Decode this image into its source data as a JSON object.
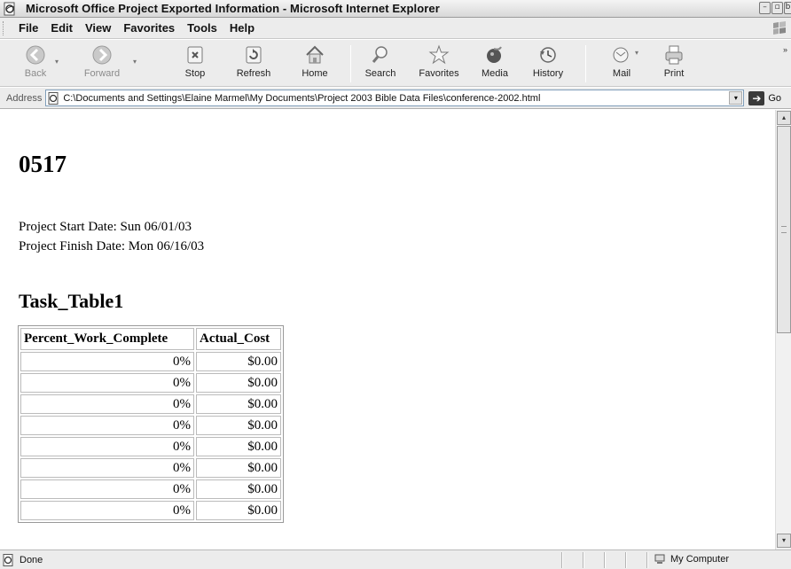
{
  "window": {
    "title": "Microsoft Office Project Exported Information - Microsoft Internet Explorer"
  },
  "menu": [
    "File",
    "Edit",
    "View",
    "Favorites",
    "Tools",
    "Help"
  ],
  "toolbar": {
    "back": "Back",
    "forward": "Forward",
    "stop": "Stop",
    "refresh": "Refresh",
    "home": "Home",
    "search": "Search",
    "favorites": "Favorites",
    "media": "Media",
    "history": "History",
    "mail": "Mail",
    "print": "Print"
  },
  "address": {
    "label": "Address",
    "url": "C:\\Documents and Settings\\Elaine Marmel\\My Documents\\Project 2003 Bible Data Files\\conference-2002.html",
    "go": "Go"
  },
  "page": {
    "heading": "0517",
    "start_date": "Project Start Date: Sun 06/01/03",
    "finish_date": "Project Finish Date: Mon 06/16/03",
    "table_title": "Task_Table1",
    "columns": [
      "Percent_Work_Complete",
      "Actual_Cost"
    ],
    "rows": [
      [
        "0%",
        "$0.00"
      ],
      [
        "0%",
        "$0.00"
      ],
      [
        "0%",
        "$0.00"
      ],
      [
        "0%",
        "$0.00"
      ],
      [
        "0%",
        "$0.00"
      ],
      [
        "0%",
        "$0.00"
      ],
      [
        "0%",
        "$0.00"
      ],
      [
        "0%",
        "$0.00"
      ]
    ]
  },
  "status": {
    "text": "Done",
    "zone": "My Computer"
  },
  "icons": {
    "back": "back-arrow-icon",
    "forward": "forward-arrow-icon",
    "stop": "stop-icon",
    "refresh": "refresh-icon",
    "home": "home-icon",
    "search": "magnifier-icon",
    "favorites": "star-icon",
    "media": "media-icon",
    "history": "history-icon",
    "mail": "envelope-icon",
    "print": "printer-icon"
  }
}
